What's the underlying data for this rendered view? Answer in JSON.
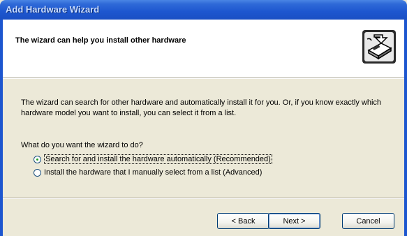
{
  "window": {
    "title": "Add Hardware Wizard"
  },
  "header": {
    "title": "The wizard can help you install other hardware",
    "icon": "hardware-wizard-icon"
  },
  "body": {
    "description": "The wizard can search for other hardware and automatically install it for you. Or, if you know exactly which hardware model you want to install, you can select it from a list.",
    "question": "What do you want the wizard to do?",
    "options": [
      {
        "label": "Search for and install the hardware automatically (Recommended)",
        "selected": true
      },
      {
        "label": "Install the hardware that I manually select from a list (Advanced)",
        "selected": false
      }
    ]
  },
  "buttons": {
    "back": "< Back",
    "next": "Next >",
    "cancel": "Cancel"
  },
  "colors": {
    "titlebar": "#1d56cf",
    "dialog_bg": "#ece9d8",
    "header_bg": "#ffffff",
    "radio_dot": "#21a121"
  }
}
